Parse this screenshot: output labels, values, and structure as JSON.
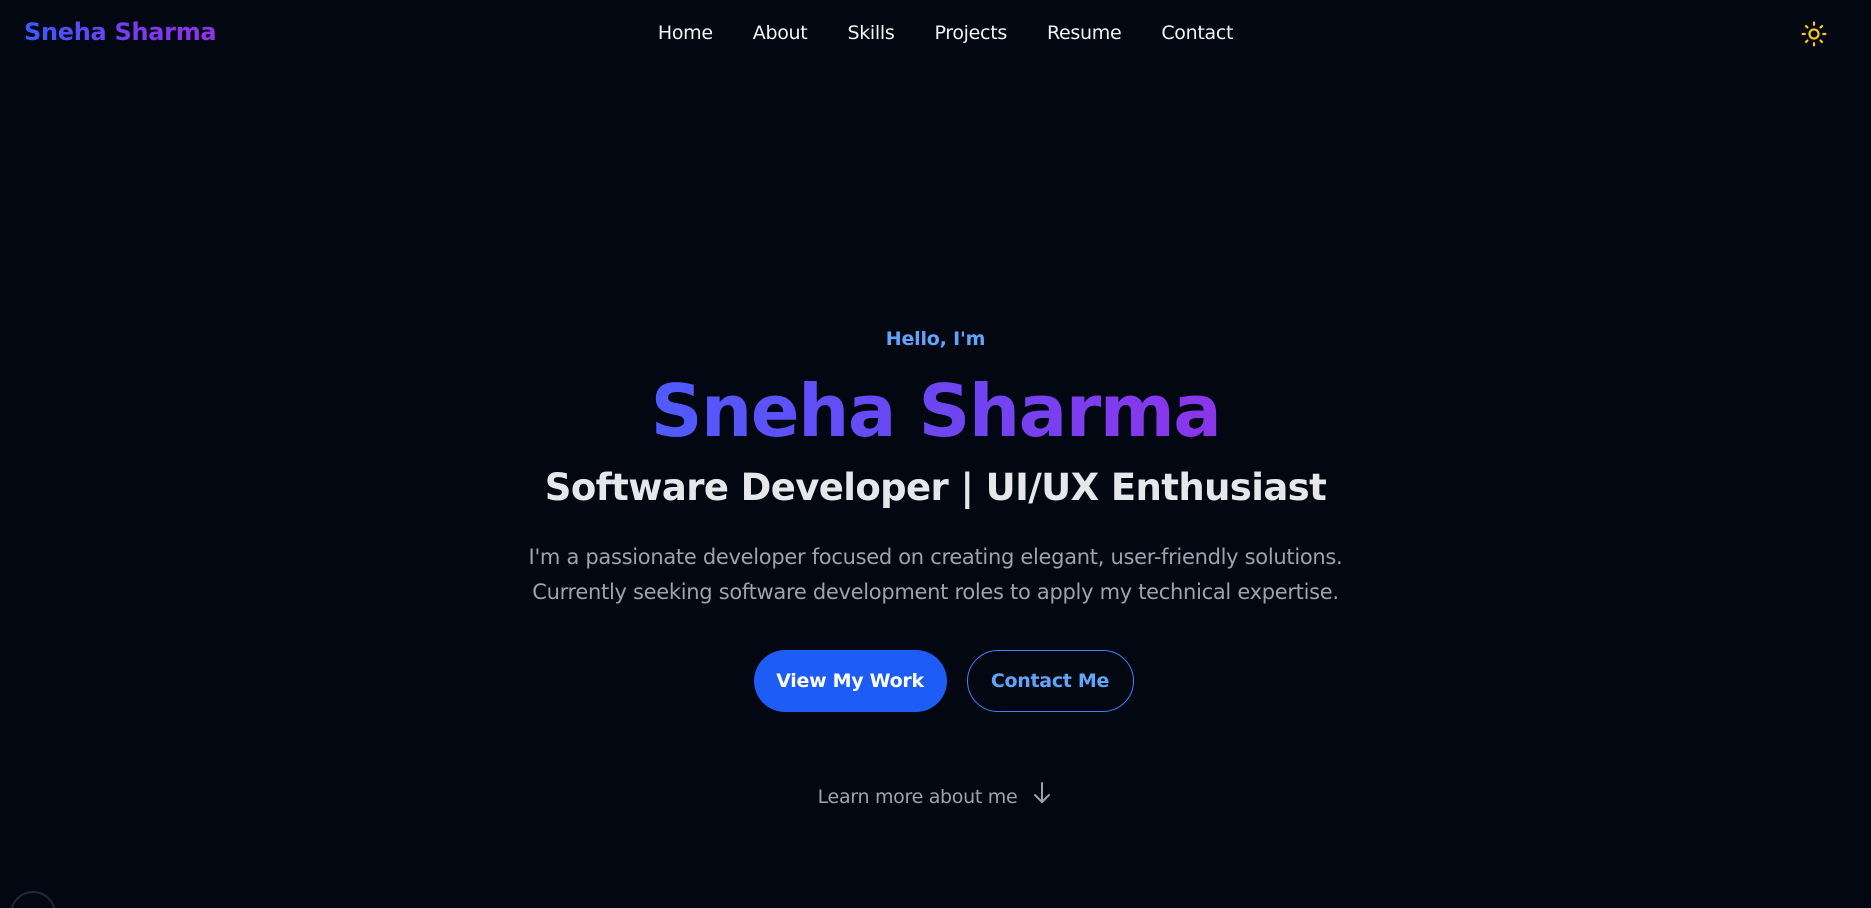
{
  "header": {
    "logo": "Sneha Sharma",
    "nav": [
      {
        "label": "Home"
      },
      {
        "label": "About"
      },
      {
        "label": "Skills"
      },
      {
        "label": "Projects"
      },
      {
        "label": "Resume"
      },
      {
        "label": "Contact"
      }
    ],
    "theme_toggle_icon": "sun-icon"
  },
  "hero": {
    "greeting": "Hello, I'm",
    "name": "Sneha Sharma",
    "subtitle": "Software Developer | UI/UX Enthusiast",
    "description_line1": "I'm a passionate developer focused on creating elegant, user-friendly solutions.",
    "description_line2": "Currently seeking software development roles to apply my technical expertise.",
    "primary_button": "View My Work",
    "secondary_button": "Contact Me",
    "learn_more": "Learn more about me",
    "learn_more_icon": "arrow-down-icon"
  },
  "colors": {
    "background": "#030712",
    "accent_blue": "#1d5cf5",
    "link_blue": "#60a5fa",
    "gradient_start": "#4f5bff",
    "gradient_end": "#8b35ea",
    "sun": "#facc15"
  }
}
